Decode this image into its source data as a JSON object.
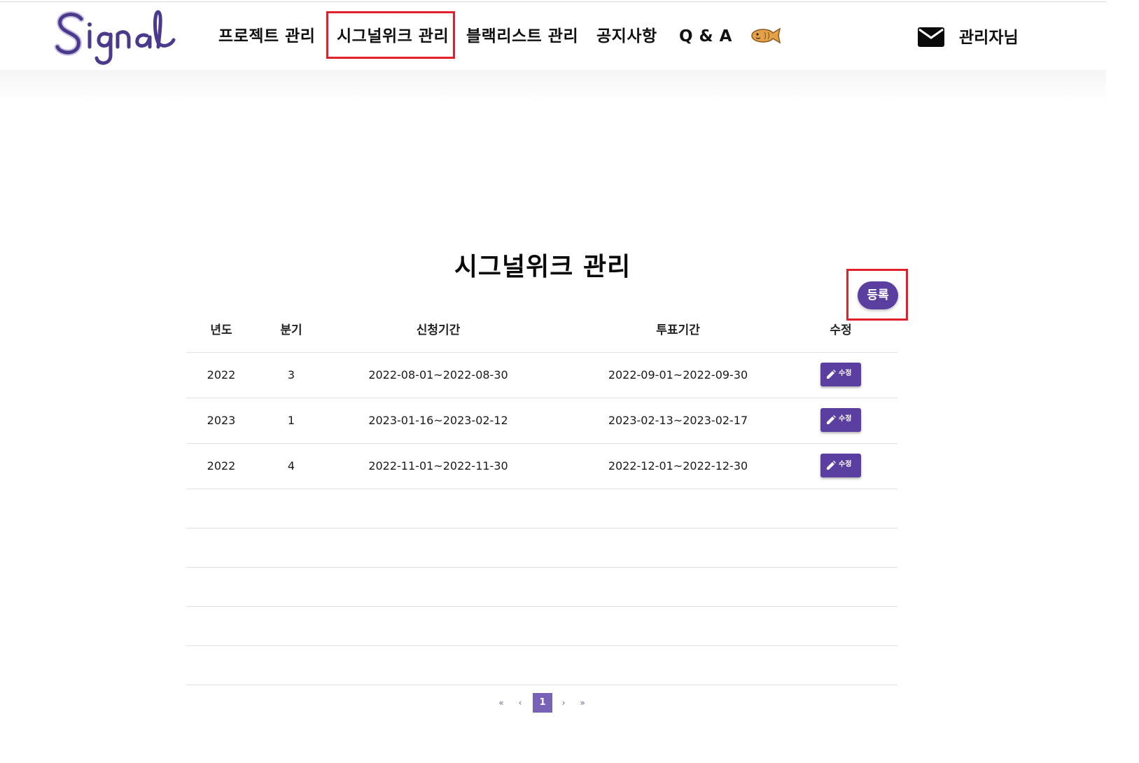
{
  "header": {
    "logo_text": "Signal",
    "nav": [
      {
        "label": "프로젝트 관리"
      },
      {
        "label": "시그널위크 관리"
      },
      {
        "label": "블랙리스트 관리"
      },
      {
        "label": "공지사항"
      },
      {
        "label": "Q & A"
      }
    ],
    "active_nav": "시그널위크 관리",
    "admin_label": "관리자님",
    "icons": [
      "fish-bread-icon",
      "mail-icon"
    ]
  },
  "main": {
    "title": "시그널위크 관리",
    "register_label": "등록",
    "columns": [
      "년도",
      "분기",
      "신청기간",
      "투표기간",
      "수정"
    ],
    "rows": [
      {
        "year": "2022",
        "quarter": "3",
        "apply": "2022-08-01~2022-08-30",
        "vote": "2022-09-01~2022-09-30",
        "edit_label": "수정"
      },
      {
        "year": "2023",
        "quarter": "1",
        "apply": "2023-01-16~2023-02-12",
        "vote": "2023-02-13~2023-02-17",
        "edit_label": "수정"
      },
      {
        "year": "2022",
        "quarter": "4",
        "apply": "2022-11-01~2022-11-30",
        "vote": "2022-12-01~2022-12-30",
        "edit_label": "수정"
      }
    ]
  },
  "pagination": {
    "first": "«",
    "prev": "‹",
    "current": "1",
    "next": "›",
    "last": "»"
  },
  "colors": {
    "accent": "#5a3fa0",
    "page_active": "#7862b8",
    "highlight_box": "#e0202a"
  }
}
